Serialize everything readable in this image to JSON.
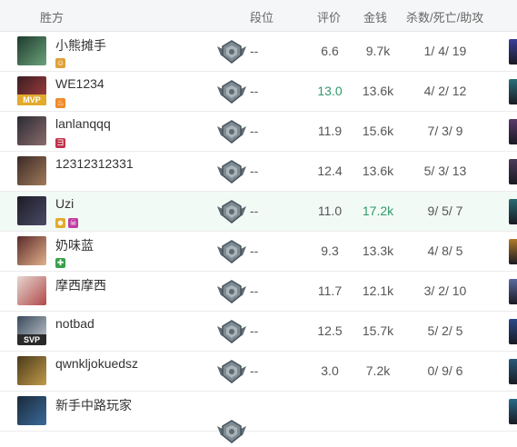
{
  "header": {
    "winner": "胜方",
    "rank": "段位",
    "rating": "评价",
    "gold": "金钱",
    "kda": "杀数/死亡/助攻"
  },
  "players": [
    {
      "name": "小熊摊手",
      "rank": "--",
      "rating": "6.6",
      "gold": "9.7k",
      "kda": "1/ 4/ 19",
      "avatar_colors": [
        "#1f3a2c",
        "#6aa37c"
      ],
      "badges": [
        {
          "color": "#e0a13a",
          "glyph": "☺"
        }
      ],
      "item_color": "#3a3f9a"
    },
    {
      "name": "WE1234",
      "tag": "MVP",
      "tag_color": "#e2ab2d",
      "rank": "--",
      "rating": "13.0",
      "rating_highlight": true,
      "gold": "13.6k",
      "kda": "4/ 2/ 12",
      "avatar_colors": [
        "#3a1e22",
        "#b04040"
      ],
      "badges": [
        {
          "color": "#f08a2a",
          "glyph": "♨"
        }
      ],
      "item_color": "#2c6f7a"
    },
    {
      "name": "lanlanqqq",
      "rank": "--",
      "rating": "11.9",
      "gold": "15.6k",
      "kda": "7/ 3/ 9",
      "avatar_colors": [
        "#2a2a33",
        "#8a6c6c"
      ],
      "badges": [
        {
          "color": "#c0324a",
          "glyph": "ヨ"
        }
      ],
      "item_color": "#5a3a6a"
    },
    {
      "name": "12312312331",
      "rank": "--",
      "rating": "12.4",
      "gold": "13.6k",
      "kda": "5/ 3/ 13",
      "avatar_colors": [
        "#3b2a26",
        "#a07a5a"
      ],
      "badges": [],
      "item_color": "#4a3a5a"
    },
    {
      "name": "Uzi",
      "highlight": true,
      "rank": "--",
      "rating": "11.0",
      "gold": "17.2k",
      "gold_highlight": true,
      "kda": "9/ 5/ 7",
      "avatar_colors": [
        "#1c1c26",
        "#4a4a66"
      ],
      "badges": [
        {
          "color": "#e2ab2d",
          "glyph": "☻"
        },
        {
          "color": "#c03aa0",
          "glyph": "☠"
        }
      ],
      "item_color": "#2a6a72"
    },
    {
      "name": "奶味蓝",
      "rank": "--",
      "rating": "9.3",
      "gold": "13.3k",
      "kda": "4/ 8/ 5",
      "avatar_colors": [
        "#5a2a2a",
        "#e2b08a"
      ],
      "badges": [
        {
          "color": "#3aa04a",
          "glyph": "✚"
        }
      ],
      "item_color": "#b07a2a"
    },
    {
      "name": "摩西摩西",
      "rank": "--",
      "rating": "11.7",
      "gold": "12.1k",
      "kda": "3/ 2/ 10",
      "avatar_colors": [
        "#e6d6d0",
        "#b04a4a"
      ],
      "badges": [],
      "item_color": "#5a6aa0"
    },
    {
      "name": "notbad",
      "tag": "SVP",
      "tag_color": "#2a2a2a",
      "rank": "--",
      "rating": "12.5",
      "gold": "15.7k",
      "kda": "5/ 2/ 5",
      "avatar_colors": [
        "#3a4a5a",
        "#c8ccd6"
      ],
      "badges": [],
      "item_color": "#2a4a8a"
    },
    {
      "name": "qwnkljokuedsz",
      "rank": "--",
      "rating": "3.0",
      "gold": "7.2k",
      "kda": "0/ 9/ 6",
      "avatar_colors": [
        "#4a3a1a",
        "#c09a4a"
      ],
      "badges": [],
      "item_color": "#2a5a7a"
    },
    {
      "name": "新手中路玩家",
      "rank": "",
      "rating": "",
      "gold": "",
      "kda": "",
      "avatar_colors": [
        "#1a2a3a",
        "#3a6a9a"
      ],
      "badges": [],
      "item_color": "#2a6a8a"
    }
  ]
}
